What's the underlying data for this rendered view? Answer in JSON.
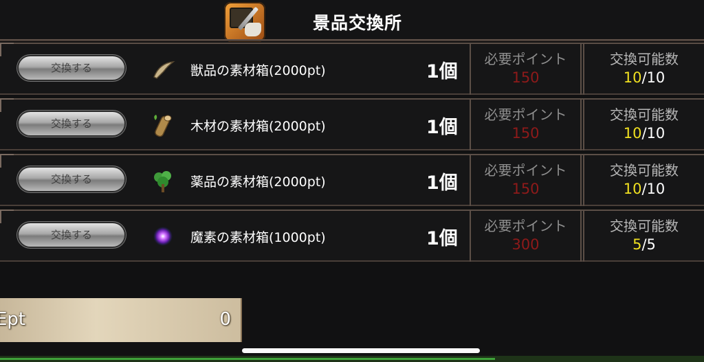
{
  "header": {
    "title": "景品交換所",
    "icon": "shop-exchange-icon"
  },
  "labels": {
    "exchange_button": "交換する",
    "required_points": "必要ポイント",
    "exchangeable_count": "交換可能数"
  },
  "rows": [
    {
      "icon": "fang-icon",
      "name": "獣品の素材箱(2000pt)",
      "qty": "1個",
      "cost": "150",
      "remaining": "10",
      "max": "/10"
    },
    {
      "icon": "log-icon",
      "name": "木材の素材箱(2000pt)",
      "qty": "1個",
      "cost": "150",
      "remaining": "10",
      "max": "/10"
    },
    {
      "icon": "herb-icon",
      "name": "薬品の素材箱(2000pt)",
      "qty": "1個",
      "cost": "150",
      "remaining": "10",
      "max": "/10"
    },
    {
      "icon": "magic-orb-icon",
      "name": "魔素の素材箱(1000pt)",
      "qty": "1個",
      "cost": "300",
      "remaining": "5",
      "max": "/5"
    }
  ],
  "points": {
    "label": "Ept",
    "value": "0"
  },
  "colors": {
    "cost": "#8e1a1a",
    "remaining": "#f0e020",
    "points_box": "#d9c9ac"
  }
}
